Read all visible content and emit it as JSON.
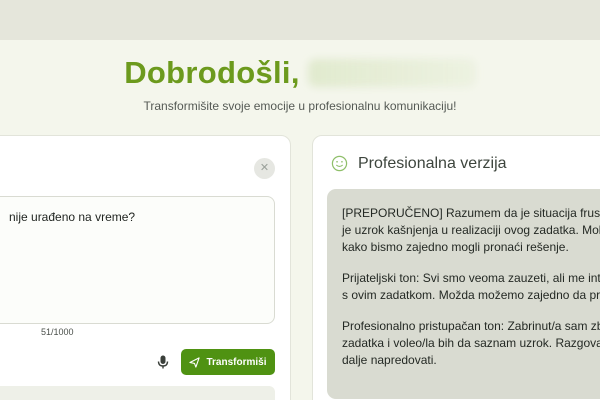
{
  "header": {
    "greeting": "Dobrodošli,",
    "subtitle": "Transformišite svoje emocije u profesionalnu komunikaciju!"
  },
  "input_panel": {
    "clear_icon": "close-icon",
    "text_value": "nije urađeno na vreme?",
    "char_count": "51/1000",
    "mic_icon": "microphone-icon",
    "send_icon": "send-icon",
    "transform_label": "Transformiši"
  },
  "output_panel": {
    "icon": "smile-icon",
    "title": "Profesionalna verzija",
    "paragraphs": [
      {
        "lines": [
          "[PREPORUČENO] Razumem da je situacija frustri",
          "je uzrok kašnjenja u realizaciji ovog zadatka. Molin",
          "kako bismo zajedno mogli pronaći rešenje."
        ]
      },
      {
        "lines": [
          "Prijateljski ton: Svi smo veoma zauzeti, ali me inter",
          "s ovim zadatkom. Možda možemo zajedno da pron"
        ]
      },
      {
        "lines": [
          "Profesionalno pristupačan ton: Zabrinut/a sam zbo",
          "zadatka i voleo/la bih da saznam uzrok. Razgovara",
          "dalje napredovati."
        ]
      }
    ]
  },
  "colors": {
    "accent_green": "#6c9a1d",
    "button_green": "#4f9212",
    "page_bg": "#f4f6ec"
  }
}
